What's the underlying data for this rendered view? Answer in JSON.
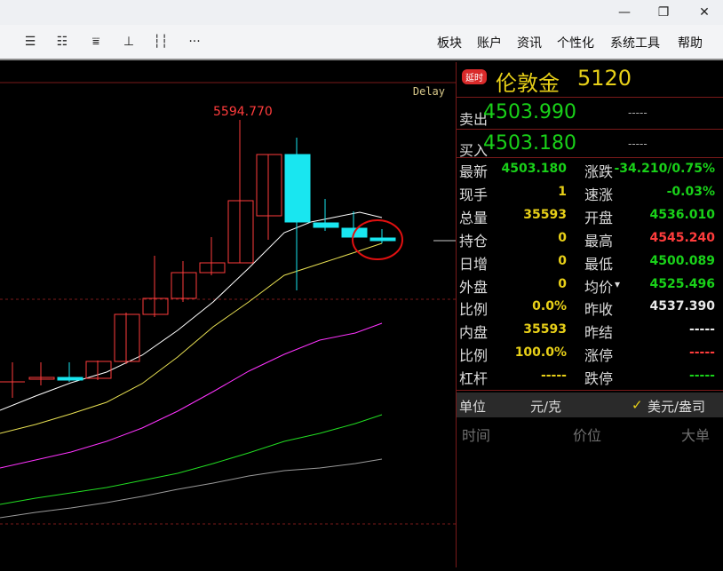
{
  "window": {
    "minimize_glyph": "—",
    "maximize_glyph": "❐",
    "close_glyph": "✕"
  },
  "toolbar": {
    "icons": [
      "list-detail-icon",
      "list-table-icon",
      "kline-icon",
      "crosshair-icon",
      "bars-icon",
      "more-icon"
    ],
    "icon_glyphs": [
      "☰",
      "☷",
      "⩸",
      "⊥",
      "┆┆",
      "···"
    ],
    "menu": [
      "板块",
      "账户",
      "资讯",
      "个性化",
      "系统工具",
      "帮助"
    ]
  },
  "chart": {
    "delay_label": "Delay",
    "high_label": "5594.770",
    "colors": {
      "up": "#ff3c3c",
      "down": "#19e6f0",
      "ma5": "#ffffff",
      "ma10": "#e8e052",
      "ma20": "#ff33ff",
      "ma30": "#22dd22",
      "ma60": "#9a9a9a",
      "highlight": "#e01010"
    }
  },
  "quote": {
    "badge": "延时",
    "name": "伦敦金",
    "code": "5120",
    "sell_label": "卖出",
    "sell_price": "4503.990",
    "sell_vol": "-----",
    "buy_label": "买入",
    "buy_price": "4503.180",
    "buy_vol": "-----"
  },
  "stats_left": [
    {
      "label": "最新",
      "value": "4503.180",
      "color": "green"
    },
    {
      "label": "现手",
      "value": "1",
      "color": "yellow"
    },
    {
      "label": "总量",
      "value": "35593",
      "color": "yellow"
    },
    {
      "label": "持仓",
      "value": "0",
      "color": "yellow"
    },
    {
      "label": "日增",
      "value": "0",
      "color": "yellow"
    },
    {
      "label": "外盘",
      "value": "0",
      "color": "yellow"
    },
    {
      "label": "比例",
      "value": "0.0%",
      "color": "yellow"
    },
    {
      "label": "内盘",
      "value": "35593",
      "color": "yellow"
    },
    {
      "label": "比例",
      "value": "100.0%",
      "color": "yellow"
    },
    {
      "label": "杠杆",
      "value": "-----",
      "color": "yellow"
    }
  ],
  "stats_right": [
    {
      "label": "涨跌",
      "value": "-34.210/0.75%",
      "color": "green"
    },
    {
      "label": "速涨",
      "value": "-0.03%",
      "color": "green"
    },
    {
      "label": "开盘",
      "value": "4536.010",
      "color": "green"
    },
    {
      "label": "最高",
      "value": "4545.240",
      "color": "red"
    },
    {
      "label": "最低",
      "value": "4500.089",
      "color": "green"
    },
    {
      "label": "均价",
      "value": "4525.496",
      "color": "green"
    },
    {
      "label": "昨收",
      "value": "4537.390",
      "color": "white"
    },
    {
      "label": "昨结",
      "value": "-----",
      "color": "white"
    },
    {
      "label": "涨停",
      "value": "-----",
      "color": "red"
    },
    {
      "label": "跌停",
      "value": "-----",
      "color": "green"
    }
  ],
  "unit": {
    "label": "单位",
    "option1": "元/克",
    "check": "✓",
    "option2": "美元/盎司"
  },
  "ticks_header": {
    "time": "时间",
    "price": "价位",
    "volume": "大单"
  }
}
